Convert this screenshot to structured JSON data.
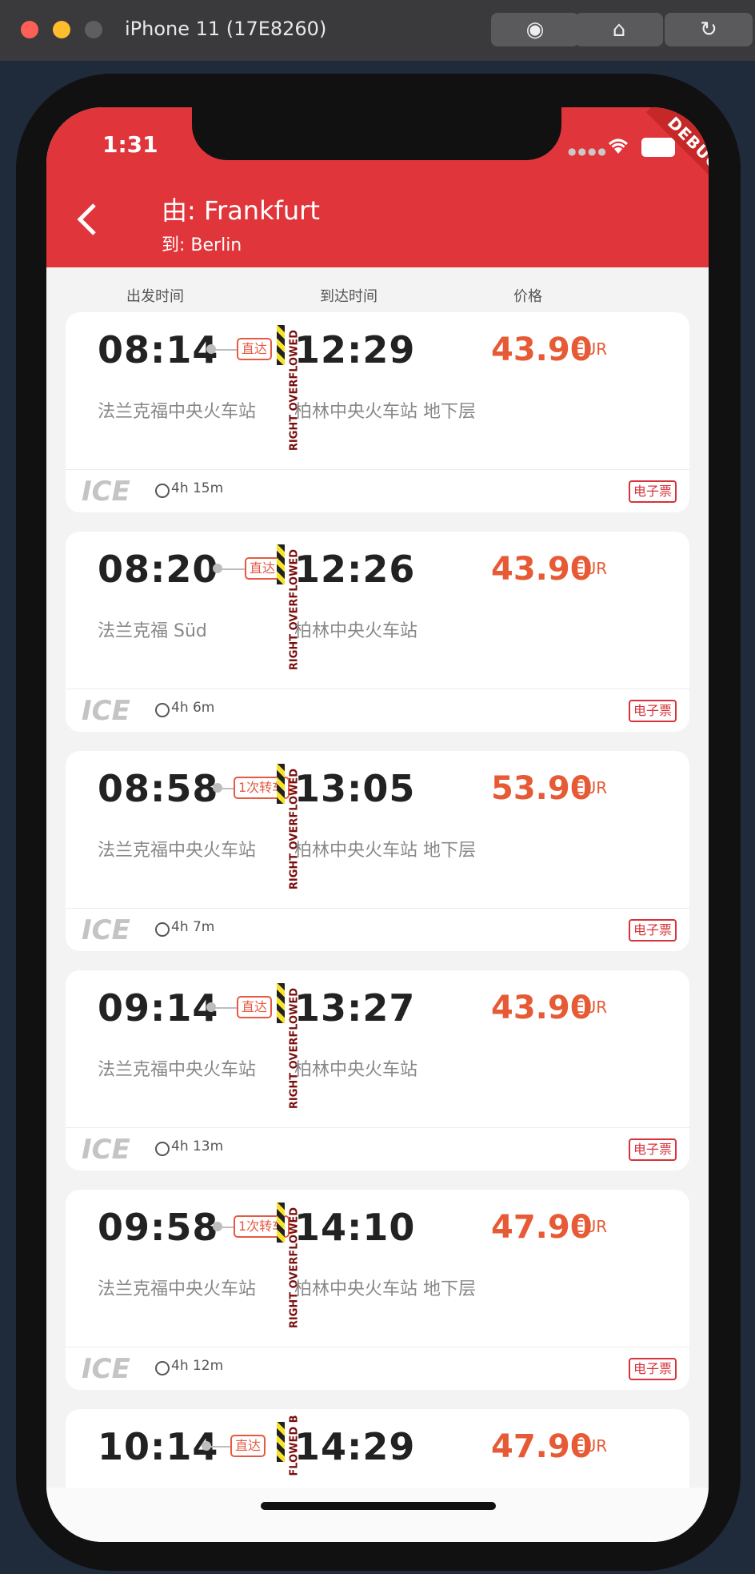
{
  "simulator": {
    "title": "iPhone 11 (17E8260)"
  },
  "status": {
    "time": "1:31",
    "debug_label": "DEBUG"
  },
  "header": {
    "from_label": "由: Frankfurt",
    "to_label": "到: Berlin"
  },
  "columns": {
    "depart": "出发时间",
    "arrive": "到达时间",
    "price": "价格"
  },
  "overflow_text": "RIGHT OVERFLOWED",
  "overflow_text_cut": "FLOWED B",
  "journeys": [
    {
      "dep_time": "08:14",
      "arr_time": "12:29",
      "tag": "直达",
      "price": "43.90",
      "currency": "EUR",
      "dep_station": "法兰克福中央火车站",
      "arr_station": "柏林中央火车站 地下层",
      "train": "ICE",
      "duration": "4h 15m",
      "ticket": "电子票"
    },
    {
      "dep_time": "08:20",
      "arr_time": "12:26",
      "tag": "直达",
      "price": "43.90",
      "currency": "EUR",
      "dep_station": "法兰克福 Süd",
      "arr_station": "柏林中央火车站",
      "train": "ICE",
      "duration": "4h 6m",
      "ticket": "电子票"
    },
    {
      "dep_time": "08:58",
      "arr_time": "13:05",
      "tag": "1次转车",
      "price": "53.90",
      "currency": "EUR",
      "dep_station": "法兰克福中央火车站",
      "arr_station": "柏林中央火车站 地下层",
      "train": "ICE",
      "duration": "4h 7m",
      "ticket": "电子票"
    },
    {
      "dep_time": "09:14",
      "arr_time": "13:27",
      "tag": "直达",
      "price": "43.90",
      "currency": "EUR",
      "dep_station": "法兰克福中央火车站",
      "arr_station": "柏林中央火车站",
      "train": "ICE",
      "duration": "4h 13m",
      "ticket": "电子票"
    },
    {
      "dep_time": "09:58",
      "arr_time": "14:10",
      "tag": "1次转车",
      "price": "47.90",
      "currency": "EUR",
      "dep_station": "法兰克福中央火车站",
      "arr_station": "柏林中央火车站 地下层",
      "train": "ICE",
      "duration": "4h 12m",
      "ticket": "电子票"
    },
    {
      "dep_time": "10:14",
      "arr_time": "14:29",
      "tag": "直达",
      "price": "47.90",
      "currency": "EUR"
    }
  ]
}
